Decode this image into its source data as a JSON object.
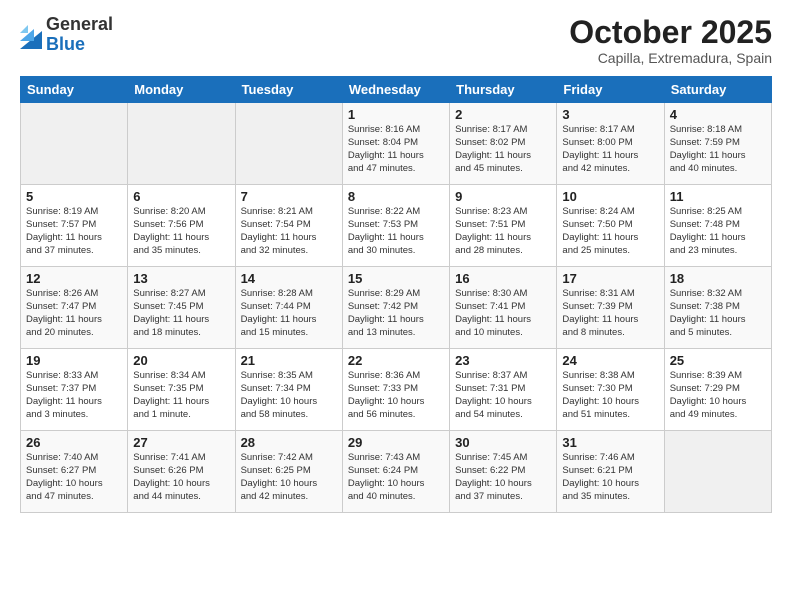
{
  "logo": {
    "general": "General",
    "blue": "Blue"
  },
  "title": {
    "month": "October 2025",
    "location": "Capilla, Extremadura, Spain"
  },
  "weekdays": [
    "Sunday",
    "Monday",
    "Tuesday",
    "Wednesday",
    "Thursday",
    "Friday",
    "Saturday"
  ],
  "weeks": [
    [
      {
        "day": "",
        "info": ""
      },
      {
        "day": "",
        "info": ""
      },
      {
        "day": "",
        "info": ""
      },
      {
        "day": "1",
        "info": "Sunrise: 8:16 AM\nSunset: 8:04 PM\nDaylight: 11 hours\nand 47 minutes."
      },
      {
        "day": "2",
        "info": "Sunrise: 8:17 AM\nSunset: 8:02 PM\nDaylight: 11 hours\nand 45 minutes."
      },
      {
        "day": "3",
        "info": "Sunrise: 8:17 AM\nSunset: 8:00 PM\nDaylight: 11 hours\nand 42 minutes."
      },
      {
        "day": "4",
        "info": "Sunrise: 8:18 AM\nSunset: 7:59 PM\nDaylight: 11 hours\nand 40 minutes."
      }
    ],
    [
      {
        "day": "5",
        "info": "Sunrise: 8:19 AM\nSunset: 7:57 PM\nDaylight: 11 hours\nand 37 minutes."
      },
      {
        "day": "6",
        "info": "Sunrise: 8:20 AM\nSunset: 7:56 PM\nDaylight: 11 hours\nand 35 minutes."
      },
      {
        "day": "7",
        "info": "Sunrise: 8:21 AM\nSunset: 7:54 PM\nDaylight: 11 hours\nand 32 minutes."
      },
      {
        "day": "8",
        "info": "Sunrise: 8:22 AM\nSunset: 7:53 PM\nDaylight: 11 hours\nand 30 minutes."
      },
      {
        "day": "9",
        "info": "Sunrise: 8:23 AM\nSunset: 7:51 PM\nDaylight: 11 hours\nand 28 minutes."
      },
      {
        "day": "10",
        "info": "Sunrise: 8:24 AM\nSunset: 7:50 PM\nDaylight: 11 hours\nand 25 minutes."
      },
      {
        "day": "11",
        "info": "Sunrise: 8:25 AM\nSunset: 7:48 PM\nDaylight: 11 hours\nand 23 minutes."
      }
    ],
    [
      {
        "day": "12",
        "info": "Sunrise: 8:26 AM\nSunset: 7:47 PM\nDaylight: 11 hours\nand 20 minutes."
      },
      {
        "day": "13",
        "info": "Sunrise: 8:27 AM\nSunset: 7:45 PM\nDaylight: 11 hours\nand 18 minutes."
      },
      {
        "day": "14",
        "info": "Sunrise: 8:28 AM\nSunset: 7:44 PM\nDaylight: 11 hours\nand 15 minutes."
      },
      {
        "day": "15",
        "info": "Sunrise: 8:29 AM\nSunset: 7:42 PM\nDaylight: 11 hours\nand 13 minutes."
      },
      {
        "day": "16",
        "info": "Sunrise: 8:30 AM\nSunset: 7:41 PM\nDaylight: 11 hours\nand 10 minutes."
      },
      {
        "day": "17",
        "info": "Sunrise: 8:31 AM\nSunset: 7:39 PM\nDaylight: 11 hours\nand 8 minutes."
      },
      {
        "day": "18",
        "info": "Sunrise: 8:32 AM\nSunset: 7:38 PM\nDaylight: 11 hours\nand 5 minutes."
      }
    ],
    [
      {
        "day": "19",
        "info": "Sunrise: 8:33 AM\nSunset: 7:37 PM\nDaylight: 11 hours\nand 3 minutes."
      },
      {
        "day": "20",
        "info": "Sunrise: 8:34 AM\nSunset: 7:35 PM\nDaylight: 11 hours\nand 1 minute."
      },
      {
        "day": "21",
        "info": "Sunrise: 8:35 AM\nSunset: 7:34 PM\nDaylight: 10 hours\nand 58 minutes."
      },
      {
        "day": "22",
        "info": "Sunrise: 8:36 AM\nSunset: 7:33 PM\nDaylight: 10 hours\nand 56 minutes."
      },
      {
        "day": "23",
        "info": "Sunrise: 8:37 AM\nSunset: 7:31 PM\nDaylight: 10 hours\nand 54 minutes."
      },
      {
        "day": "24",
        "info": "Sunrise: 8:38 AM\nSunset: 7:30 PM\nDaylight: 10 hours\nand 51 minutes."
      },
      {
        "day": "25",
        "info": "Sunrise: 8:39 AM\nSunset: 7:29 PM\nDaylight: 10 hours\nand 49 minutes."
      }
    ],
    [
      {
        "day": "26",
        "info": "Sunrise: 7:40 AM\nSunset: 6:27 PM\nDaylight: 10 hours\nand 47 minutes."
      },
      {
        "day": "27",
        "info": "Sunrise: 7:41 AM\nSunset: 6:26 PM\nDaylight: 10 hours\nand 44 minutes."
      },
      {
        "day": "28",
        "info": "Sunrise: 7:42 AM\nSunset: 6:25 PM\nDaylight: 10 hours\nand 42 minutes."
      },
      {
        "day": "29",
        "info": "Sunrise: 7:43 AM\nSunset: 6:24 PM\nDaylight: 10 hours\nand 40 minutes."
      },
      {
        "day": "30",
        "info": "Sunrise: 7:45 AM\nSunset: 6:22 PM\nDaylight: 10 hours\nand 37 minutes."
      },
      {
        "day": "31",
        "info": "Sunrise: 7:46 AM\nSunset: 6:21 PM\nDaylight: 10 hours\nand 35 minutes."
      },
      {
        "day": "",
        "info": ""
      }
    ]
  ]
}
